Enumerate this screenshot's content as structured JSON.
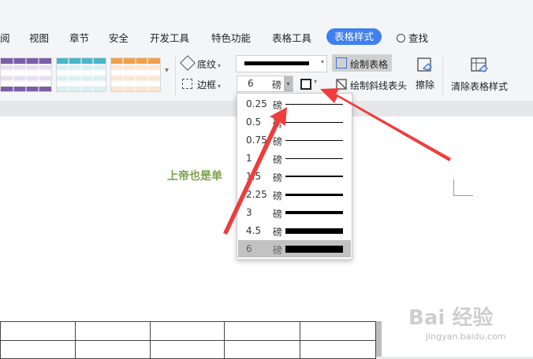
{
  "tabs": [
    {
      "label": "阅"
    },
    {
      "label": "视图"
    },
    {
      "label": "章节"
    },
    {
      "label": "安全"
    },
    {
      "label": "开发工具"
    },
    {
      "label": "特色功能"
    },
    {
      "label": "表格工具"
    },
    {
      "label": "表格样式",
      "active": true
    },
    {
      "label": "查找"
    }
  ],
  "ribbon": {
    "shading_label": "底纹",
    "border_label": "边框",
    "draw_table_label": "绘制表格",
    "draw_diagonal_label": "绘制斜线表头",
    "erase_label": "擦除",
    "clear_style_label": "清除表格样式",
    "line_width_value": "6",
    "line_width_unit": "磅"
  },
  "swatch_colors": [
    "#7b5ea7",
    "#47b7c9",
    "#f0a04b"
  ],
  "dropdown": {
    "items": [
      {
        "value": "0.25",
        "unit": "磅",
        "weight": 0.25
      },
      {
        "value": "0.5",
        "unit": "磅",
        "weight": 0.5
      },
      {
        "value": "0.75",
        "unit": "磅",
        "weight": 0.75
      },
      {
        "value": "1",
        "unit": "磅",
        "weight": 1
      },
      {
        "value": "1.5",
        "unit": "磅",
        "weight": 1.5
      },
      {
        "value": "2.25",
        "unit": "磅",
        "weight": 2.25
      },
      {
        "value": "3",
        "unit": "磅",
        "weight": 3
      },
      {
        "value": "4.5",
        "unit": "磅",
        "weight": 4.5
      },
      {
        "value": "6",
        "unit": "磅",
        "weight": 6,
        "selected": true
      }
    ]
  },
  "document": {
    "title_text": "上帝也是单"
  },
  "annotation_color": "#f03c3c",
  "watermark": {
    "text": "Bai 经验",
    "subtext": "jingyan.baidu.com"
  }
}
